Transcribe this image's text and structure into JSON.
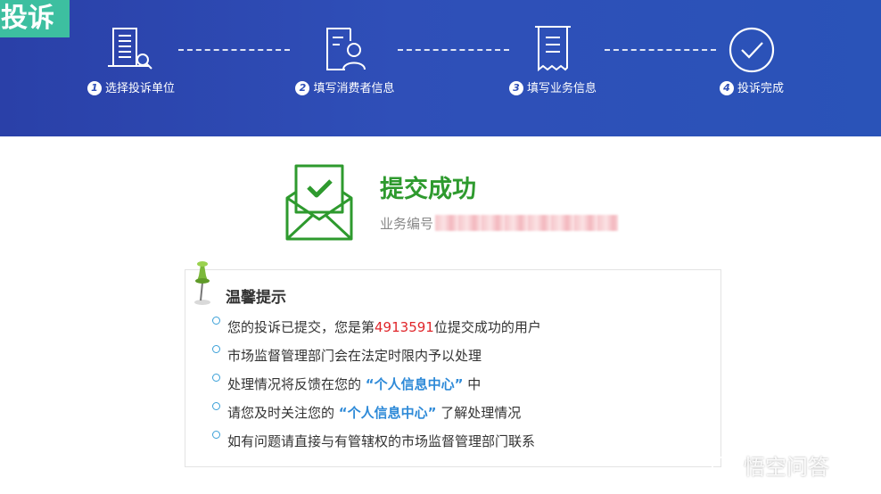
{
  "banner": {
    "tag": "投诉",
    "steps": [
      {
        "num": "1",
        "label": "选择投诉单位",
        "icon": "building-search-icon"
      },
      {
        "num": "2",
        "label": "填写消费者信息",
        "icon": "user-form-icon"
      },
      {
        "num": "3",
        "label": "填写业务信息",
        "icon": "receipt-icon"
      },
      {
        "num": "4",
        "label": "投诉完成",
        "icon": "check-circle-icon"
      }
    ],
    "colors": {
      "background": "#2f4fb8",
      "tag_bg": "#3dbfa0"
    }
  },
  "success": {
    "title": "提交成功",
    "order_label": "业务编号",
    "icon": "envelope-check-icon",
    "color": "#2e9a2e"
  },
  "tips": {
    "title": "温馨提示",
    "icon": "pin-icon",
    "items": {
      "i1_pre": "您的投诉已提交，您是第",
      "i1_num": "4913591",
      "i1_post": "位提交成功的用户",
      "i2": "市场监督管理部门会在法定时限内予以处理",
      "i3_pre": "处理情况将反馈在您的",
      "i3_link": "“个人信息中心”",
      "i3_post": "中",
      "i4_pre": "请您及时关注您的",
      "i4_link": "“个人信息中心”",
      "i4_post": "了解处理情况",
      "i5": "如有问题请直接与有管辖权的市场监督管理部门联系"
    }
  },
  "watermark": {
    "text": "悟空问答",
    "icon": "chat-bubble-icon"
  }
}
